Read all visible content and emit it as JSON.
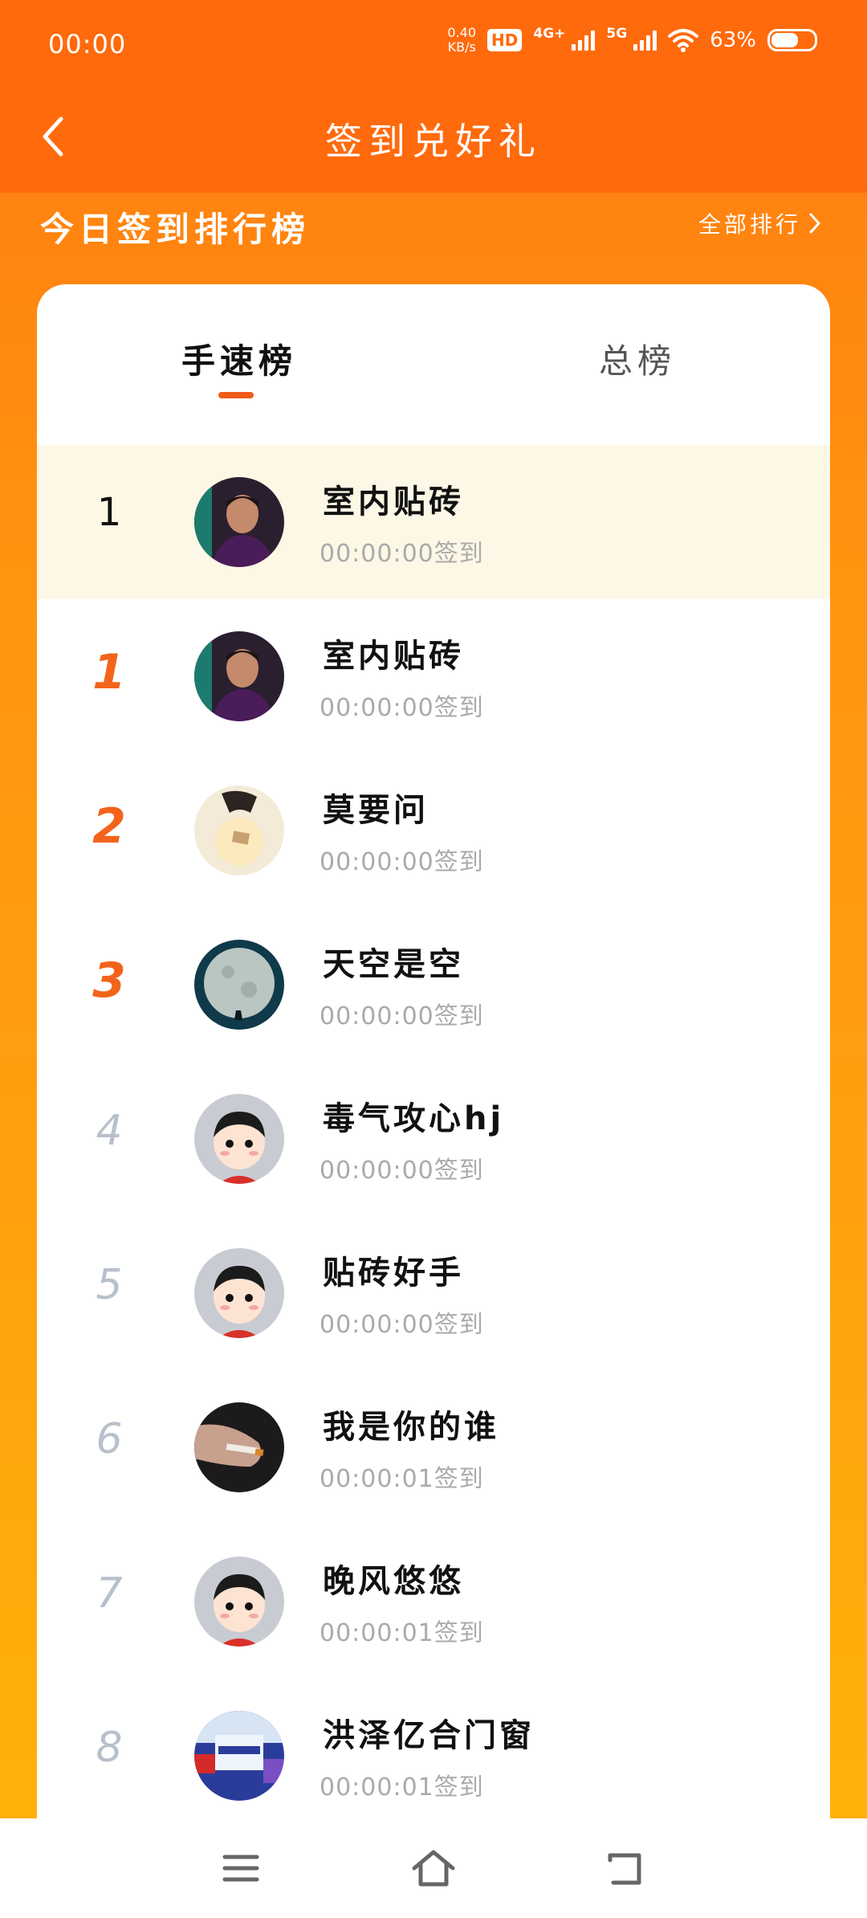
{
  "status": {
    "time": "00:00",
    "speed_value": "0.40",
    "speed_unit": "KB/s",
    "hd": "HD",
    "net1": "4G+",
    "net2": "5G",
    "battery": "63%"
  },
  "nav": {
    "title": "签到兑好礼"
  },
  "ranking": {
    "title": "今日签到排行榜",
    "all_link": "全部排行"
  },
  "tabs": [
    {
      "label": "手速榜",
      "active": true
    },
    {
      "label": "总榜",
      "active": false
    }
  ],
  "rows": [
    {
      "rank": "1",
      "name": "室内贴砖",
      "time": "00:00:00签到",
      "avatar": "man-portrait-avatar"
    },
    {
      "rank": "1",
      "name": "室内贴砖",
      "time": "00:00:00签到",
      "avatar": "man-portrait-avatar"
    },
    {
      "rank": "2",
      "name": "莫要问",
      "time": "00:00:00签到",
      "avatar": "hand-card-avatar"
    },
    {
      "rank": "3",
      "name": "天空是空",
      "time": "00:00:00签到",
      "avatar": "moon-avatar"
    },
    {
      "rank": "4",
      "name": "毒气攻心hj",
      "time": "00:00:00签到",
      "avatar": "cartoon-kid-avatar"
    },
    {
      "rank": "5",
      "name": "贴砖好手",
      "time": "00:00:00签到",
      "avatar": "cartoon-kid-avatar"
    },
    {
      "rank": "6",
      "name": "我是你的谁",
      "time": "00:00:01签到",
      "avatar": "hand-cigarette-avatar"
    },
    {
      "rank": "7",
      "name": "晚风悠悠",
      "time": "00:00:01签到",
      "avatar": "cartoon-kid-avatar"
    },
    {
      "rank": "8",
      "name": "洪泽亿合门窗",
      "time": "00:00:01签到",
      "avatar": "store-sign-avatar"
    }
  ]
}
